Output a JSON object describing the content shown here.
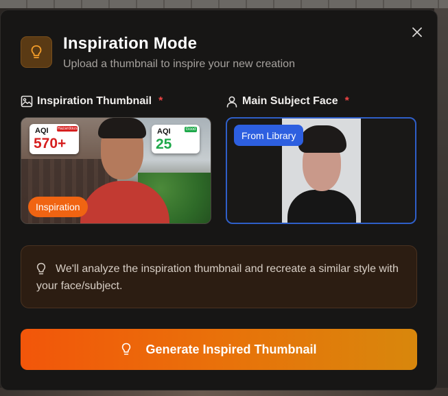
{
  "modal": {
    "title": "Inspiration Mode",
    "subtitle": "Upload a thumbnail to inspire your new creation",
    "header_icon": "lightbulb-icon",
    "close_icon": "close-icon"
  },
  "inspiration": {
    "label": "Inspiration Thumbnail",
    "required_mark": "*",
    "label_icon": "image-icon",
    "badge": "Inspiration",
    "thumbnail": {
      "card1_label": "AQI",
      "card1_value": "570+",
      "card1_tag": "Hazardous",
      "card2_label": "AQI",
      "card2_value": "25",
      "card2_tag": "Good"
    }
  },
  "subject": {
    "label": "Main Subject Face",
    "required_mark": "*",
    "label_icon": "user-icon",
    "badge": "From Library"
  },
  "info": {
    "icon": "lightbulb-icon",
    "text": "We'll analyze the inspiration thumbnail and recreate a similar style with your face/subject."
  },
  "generate_button": {
    "icon": "lightbulb-icon",
    "label": "Generate Inspired Thumbnail"
  },
  "colors": {
    "accent_orange": "#f06412",
    "accent_blue": "#2d5fe0",
    "required_red": "#ef4444",
    "modal_bg": "#171615"
  }
}
